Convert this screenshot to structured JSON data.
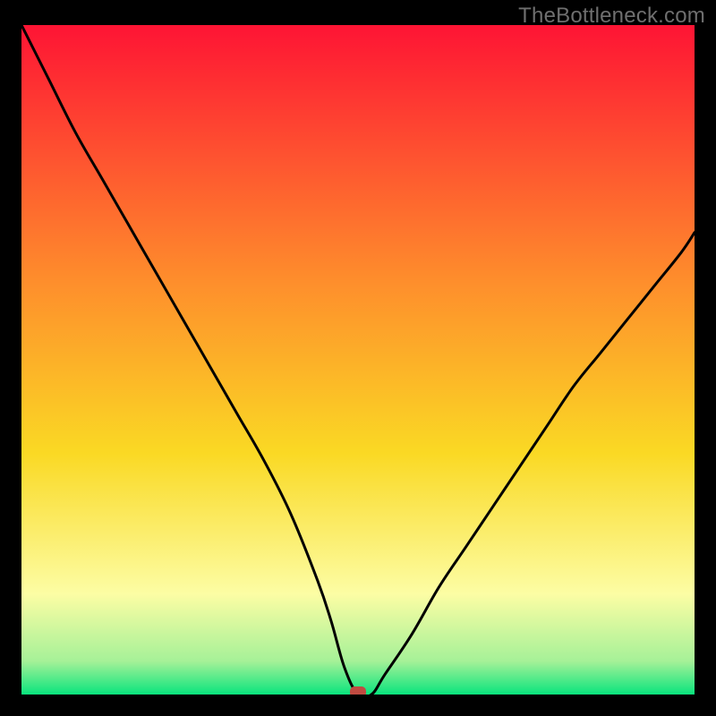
{
  "watermark": {
    "text": "TheBottleneck.com"
  },
  "colors": {
    "black": "#000000",
    "gradient_top": "#fe1434",
    "gradient_mid1": "#fe8d2c",
    "gradient_mid2": "#fad924",
    "gradient_mid3": "#fcfda4",
    "gradient_mid4": "#a6f198",
    "gradient_bottom": "#0ae47d",
    "curve": "#000000",
    "marker": "#c04a41"
  },
  "chart_data": {
    "type": "line",
    "title": "",
    "xlabel": "",
    "ylabel": "",
    "xlim": [
      0,
      100
    ],
    "ylim": [
      0,
      100
    ],
    "grid": false,
    "legend": false,
    "annotations": [
      {
        "name": "marker",
        "x": 50,
        "y": 0
      }
    ],
    "series": [
      {
        "name": "bottleneck-curve",
        "x": [
          0,
          4,
          8,
          12,
          16,
          20,
          24,
          28,
          32,
          36,
          40,
          44,
          46,
          48,
          50,
          52,
          54,
          58,
          62,
          66,
          70,
          74,
          78,
          82,
          86,
          90,
          94,
          98,
          100
        ],
        "y": [
          100,
          92,
          84,
          77,
          70,
          63,
          56,
          49,
          42,
          35,
          27,
          17,
          11,
          4,
          0,
          0,
          3,
          9,
          16,
          22,
          28,
          34,
          40,
          46,
          51,
          56,
          61,
          66,
          69
        ]
      }
    ]
  }
}
